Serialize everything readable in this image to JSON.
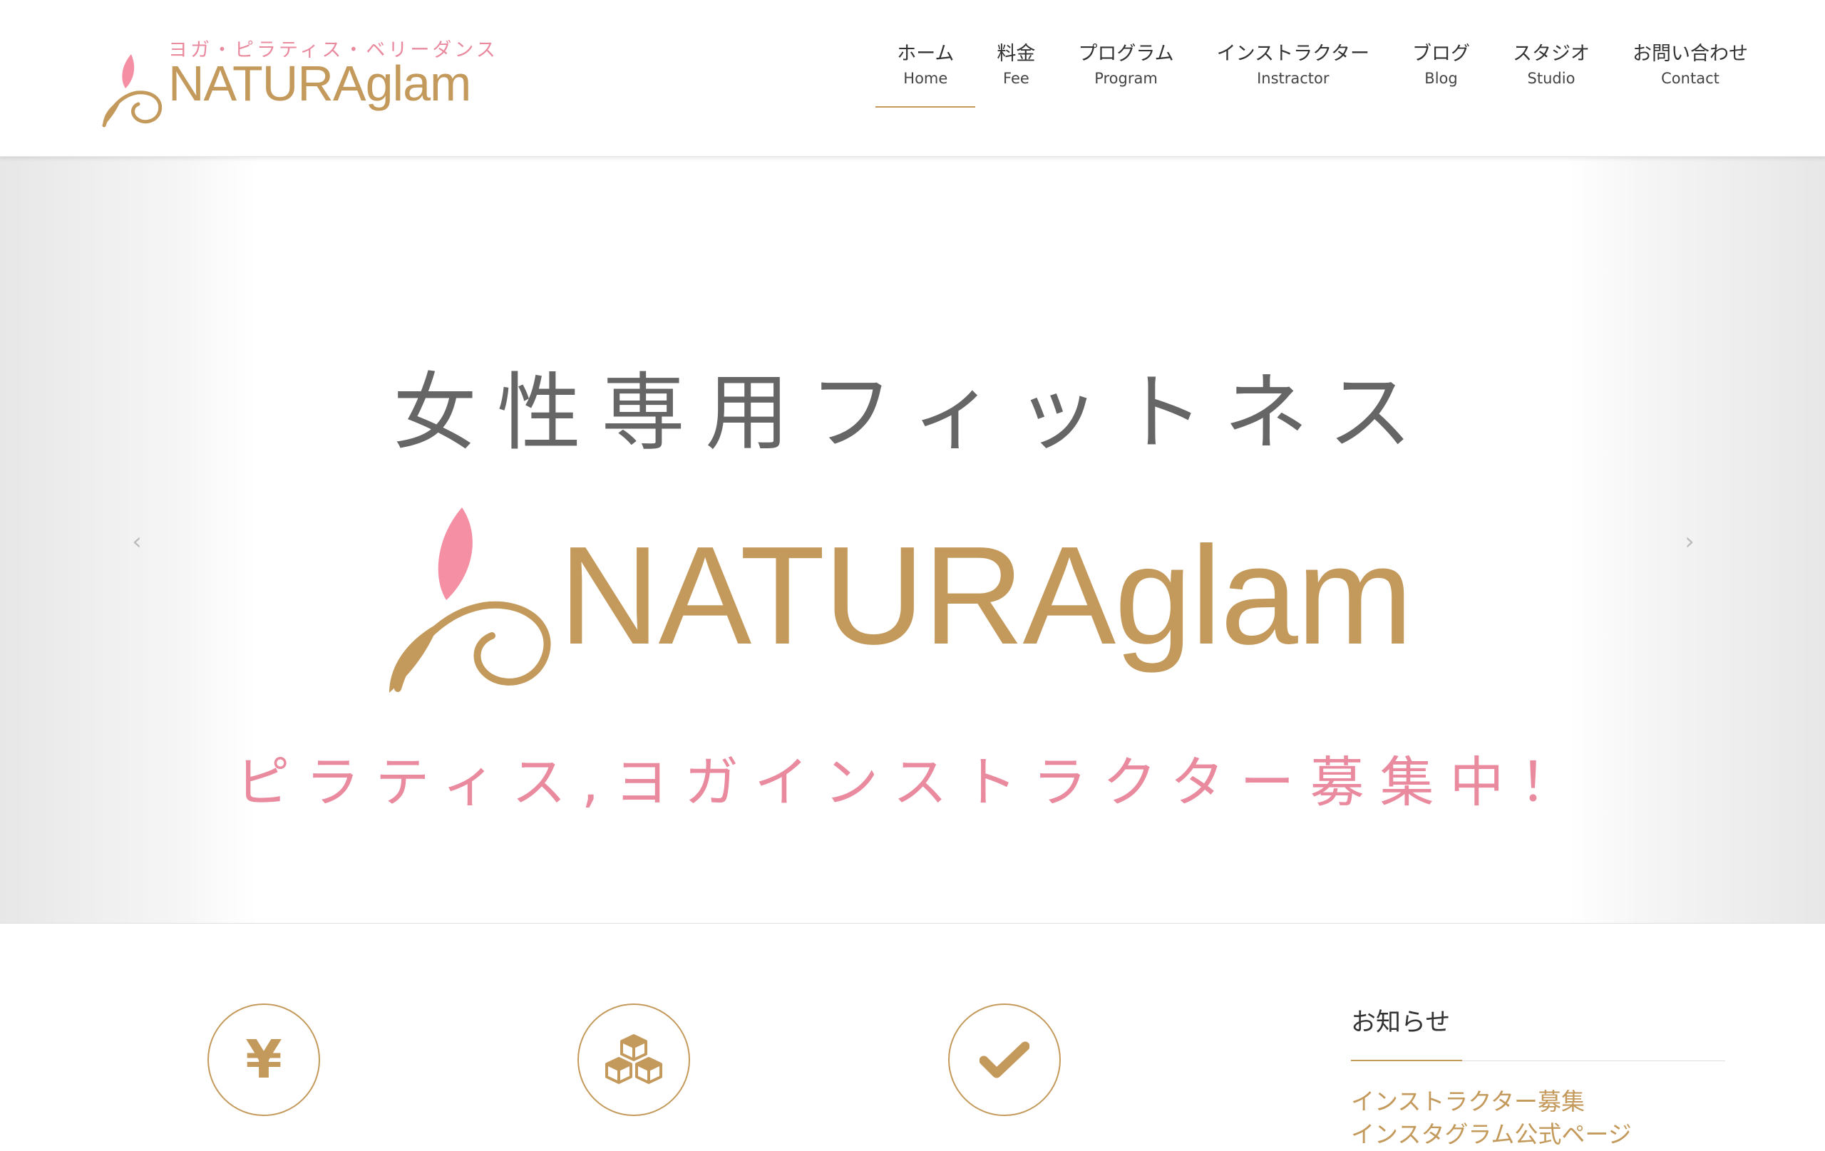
{
  "header": {
    "logo": {
      "tagline": "ヨガ・ピラティス・ベリーダンス",
      "wordmark": "NATURAglam"
    },
    "nav": [
      {
        "jp": "ホーム",
        "en": "Home",
        "active": true
      },
      {
        "jp": "料金",
        "en": "Fee"
      },
      {
        "jp": "プログラム",
        "en": "Program"
      },
      {
        "jp": "インストラクター",
        "en": "Instractor"
      },
      {
        "jp": "ブログ",
        "en": "Blog"
      },
      {
        "jp": "スタジオ",
        "en": "Studio"
      },
      {
        "jp": "お問い合わせ",
        "en": "Contact"
      }
    ]
  },
  "hero": {
    "title": "女性専用フィットネス",
    "wordmark": "NATURAglam",
    "recruit": "ピラティス,ヨガインストラクター募集中！",
    "prev_arrow": "‹",
    "next_arrow": "›"
  },
  "features": [
    {
      "icon": "yen-icon",
      "glyph": "¥"
    },
    {
      "icon": "cubes-icon"
    },
    {
      "icon": "check-icon"
    }
  ],
  "news": {
    "heading": "お知らせ",
    "items": [
      "インストラクター募集",
      "インスタグラム公式ページ"
    ]
  },
  "colors": {
    "gold": "#c49a5c",
    "pink": "#e98a9f",
    "grey_text": "#666666"
  }
}
